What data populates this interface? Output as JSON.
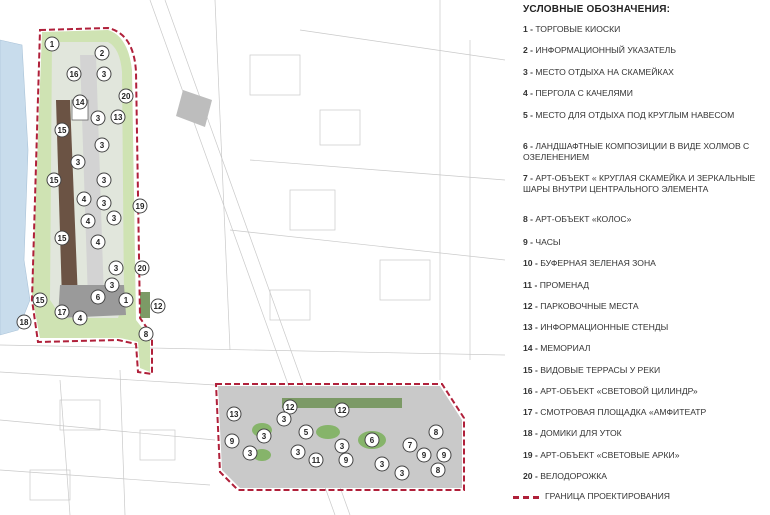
{
  "legend": {
    "title": "УСЛОВНЫЕ ОБОЗНАЧЕНИЯ:",
    "items": [
      {
        "num": "1 -",
        "label": "ТОРГОВЫЕ КИОСКИ"
      },
      {
        "num": "2 -",
        "label": "ИНФОРМАЦИОННЫЙ УКАЗАТЕЛЬ"
      },
      {
        "num": "3 -",
        "label": "МЕСТО ОТДЫХА НА СКАМЕЙКАХ"
      },
      {
        "num": "4 -",
        "label": "ПЕРГОЛА С КАЧЕЛЯМИ"
      },
      {
        "num": "5 -",
        "label": "МЕСТО ДЛЯ ОТДЫХА ПОД  КРУГЛЫМ НАВЕСОМ"
      },
      {
        "num": "6 -",
        "label": "ЛАНДШАФТНЫЕ КОМПОЗИЦИИ В ВИДЕ ХОЛМОВ С ОЗЕЛЕНЕНИЕМ"
      },
      {
        "num": "7 -",
        "label": "АРТ-ОБЪЕКТ « КРУГЛАЯ СКАМЕЙКА И ЗЕРКАЛЬНЫЕ ШАРЫ ВНУТРИ ЦЕНТРАЛЬНОГО ЭЛЕМЕНТА"
      },
      {
        "num": "8 -",
        "label": "АРТ-ОБЪЕКТ «КОЛОС»"
      },
      {
        "num": "9 -",
        "label": "ЧАСЫ"
      },
      {
        "num": "10 -",
        "label": "БУФЕРНАЯ ЗЕЛЕНАЯ ЗОНА"
      },
      {
        "num": "11 -",
        "label": "ПРОМЕНАД"
      },
      {
        "num": "12 -",
        "label": "ПАРКОВОЧНЫЕ МЕСТА"
      },
      {
        "num": "13 -",
        "label": "ИНФОРМАЦИОННЫЕ СТЕНДЫ"
      },
      {
        "num": "14 -",
        "label": " МЕМОРИАЛ"
      },
      {
        "num": "15 -",
        "label": "ВИДОВЫЕ ТЕРРАСЫ У РЕКИ"
      },
      {
        "num": "16 -",
        "label": "АРТ-ОБЪЕКТ «СВЕТОВОЙ ЦИЛИНДР»"
      },
      {
        "num": "17 -",
        "label": "СМОТРОВАЯ ПЛОЩАДКА «АМФИТЕАТР"
      },
      {
        "num": "18 -",
        "label": "ДОМИКИ ДЛЯ УТОК"
      },
      {
        "num": "19 -",
        "label": "АРТ-ОБЪЕКТ «СВЕТОВЫЕ АРКИ»"
      },
      {
        "num": "20 -",
        "label": " ВЕЛОДОРОЖКА"
      }
    ],
    "boundary_label": "ГРАНИЦА ПРОЕКТИРОВАНИЯ"
  },
  "map": {
    "markers_north": [
      "1",
      "2",
      "16",
      "3",
      "20",
      "14",
      "3",
      "13",
      "15",
      "3",
      "3",
      "15",
      "3",
      "4",
      "3",
      "19",
      "4",
      "3",
      "15",
      "4",
      "3",
      "20",
      "3",
      "15",
      "1",
      "6",
      "12",
      "17",
      "4",
      "18",
      "8"
    ],
    "markers_south": [
      "12",
      "12",
      "13",
      "3",
      "5",
      "3",
      "6",
      "3",
      "7",
      "8",
      "9",
      "3",
      "3",
      "11",
      "9",
      "3",
      "9",
      "9",
      "8",
      "3"
    ],
    "colors": {
      "boundary": "#b0203a",
      "green": "#cfe3b3",
      "path": "#b7b7b7",
      "terrace": "#6b5344",
      "water": "#c8dcec"
    }
  }
}
